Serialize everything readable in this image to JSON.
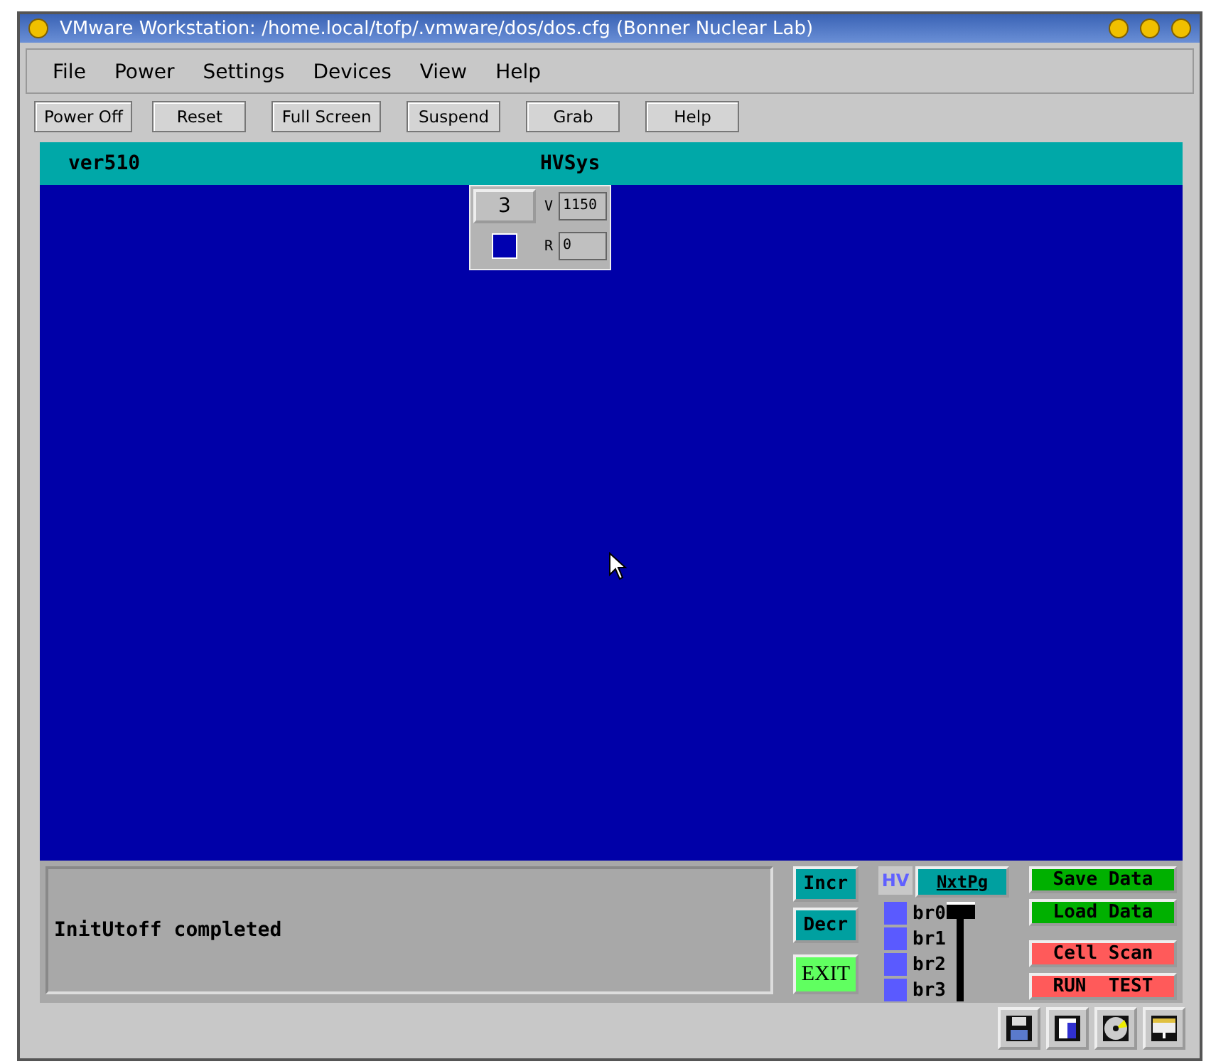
{
  "window": {
    "title": "VMware Workstation: /home.local/tofp/.vmware/dos/dos.cfg (Bonner Nuclear Lab)"
  },
  "menu": [
    "File",
    "Power",
    "Settings",
    "Devices",
    "View",
    "Help"
  ],
  "toolbar": [
    "Power Off",
    "Reset",
    "Full Screen",
    "Suspend",
    "Grab",
    "Help"
  ],
  "guest": {
    "header_left": "ver510",
    "header_center": "HVSys",
    "channel": {
      "number": "3",
      "v_label": "V",
      "v_value": "1150",
      "r_label": "R",
      "r_value": "0"
    },
    "message": "InitUtoff completed",
    "left_buttons": [
      {
        "label": "Incr",
        "color": "#00a0a0"
      },
      {
        "label": "Decr",
        "color": "#00a0a0"
      },
      {
        "label": "EXIT",
        "color": "#60ff60"
      }
    ],
    "hv_label": "HV",
    "next_page": "NxtPg",
    "branches": [
      "br0",
      "br1",
      "br2",
      "br3"
    ],
    "slider": {
      "level": 1
    },
    "right_buttons": [
      {
        "label": "Save Data",
        "color": "#00b000"
      },
      {
        "label": "Load Data",
        "color": "#00b000"
      },
      {
        "label": "Cell Scan",
        "color": "#ff5a5a"
      },
      {
        "label": "RUN  TEST",
        "color": "#ff5a5a"
      }
    ]
  }
}
